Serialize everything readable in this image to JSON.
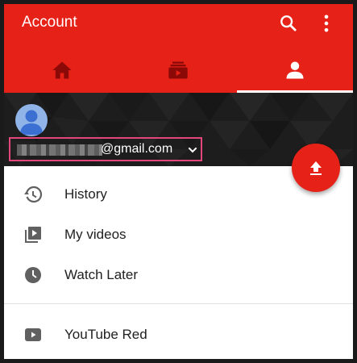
{
  "appbar": {
    "title": "Account",
    "search_icon": "search-icon",
    "more_icon": "more-vert-icon",
    "color": "#e62117"
  },
  "tabs": [
    {
      "name": "home",
      "icon": "home-icon",
      "active": false
    },
    {
      "name": "subscriptions",
      "icon": "subscriptions-icon",
      "active": false
    },
    {
      "name": "account",
      "icon": "person-icon",
      "active": true
    }
  ],
  "header": {
    "email_suffix": "@gmail.com",
    "highlight_color": "#e4457a"
  },
  "fab": {
    "icon": "upload-icon"
  },
  "menu": {
    "items": [
      {
        "label": "History",
        "icon": "history-icon"
      },
      {
        "label": "My videos",
        "icon": "my-videos-icon"
      },
      {
        "label": "Watch Later",
        "icon": "clock-icon"
      }
    ],
    "secondary": [
      {
        "label": "YouTube Red",
        "icon": "youtube-red-icon"
      }
    ]
  }
}
